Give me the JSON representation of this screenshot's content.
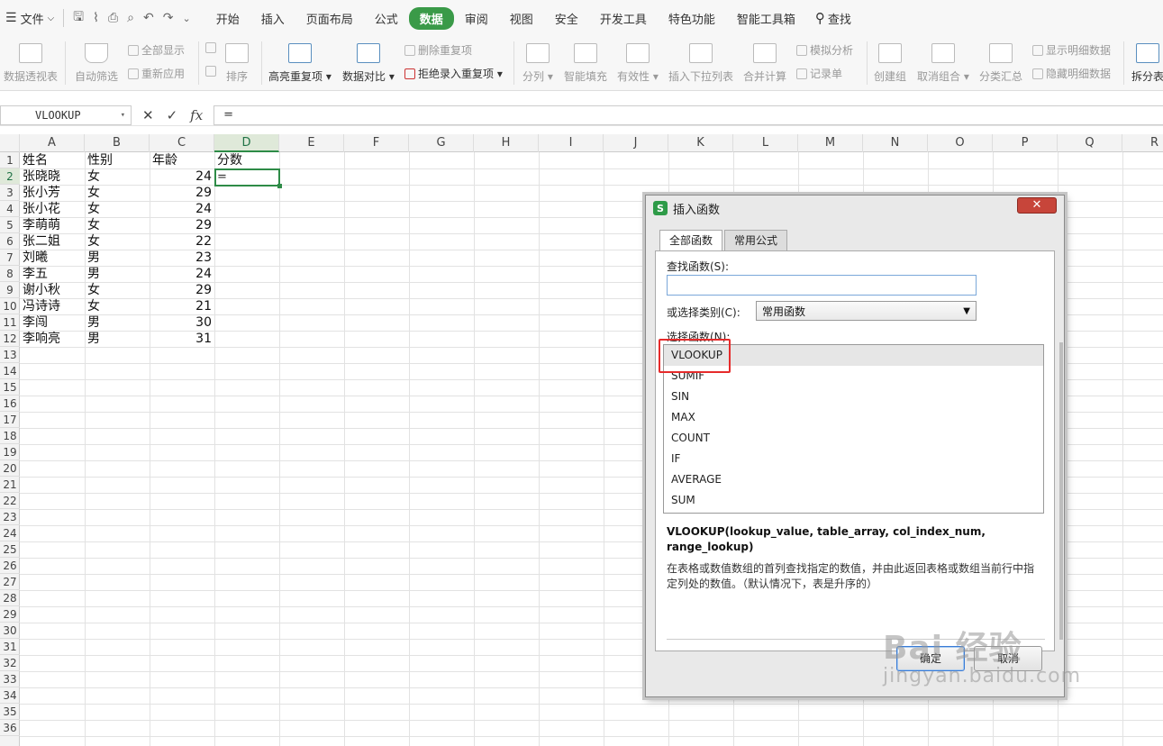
{
  "menubar": {
    "file_label": "文件",
    "tabs": [
      "开始",
      "插入",
      "页面布局",
      "公式",
      "数据",
      "审阅",
      "视图",
      "安全",
      "开发工具",
      "特色功能",
      "智能工具箱"
    ],
    "active_tab": "数据",
    "search_label": "查找"
  },
  "ribbon": {
    "pivot": "数据透视表",
    "autofilter": "自动筛选",
    "show_all": "全部显示",
    "reapply": "重新应用",
    "sort": "排序",
    "highlight_dup": "高亮重复项",
    "compare": "数据对比",
    "remove_dup": "删除重复项",
    "reject_dup": "拒绝录入重复项",
    "split": "分列",
    "smart_fill": "智能填充",
    "validity": "有效性",
    "dropdown": "插入下拉列表",
    "consolidate": "合并计算",
    "simulate": "模拟分析",
    "record": "记录单",
    "create_group": "创建组",
    "ungroup": "取消组合",
    "subtotal": "分类汇总",
    "show_detail": "显示明细数据",
    "hide_detail": "隐藏明细数据",
    "split_table": "拆分表"
  },
  "formula_bar": {
    "name_box": "VLOOKUP",
    "fx_label": "fx",
    "content": "="
  },
  "sheet": {
    "columns": [
      "A",
      "B",
      "C",
      "D",
      "E",
      "F",
      "G",
      "H",
      "I",
      "J",
      "K",
      "L",
      "M",
      "N",
      "O",
      "P",
      "Q",
      "R"
    ],
    "selected_column": "D",
    "rows": [
      "1",
      "2",
      "3",
      "4",
      "5",
      "6",
      "7",
      "8",
      "9",
      "10",
      "11",
      "12",
      "13",
      "14",
      "15",
      "16",
      "17",
      "18",
      "19",
      "20",
      "21",
      "22",
      "23",
      "24",
      "25",
      "26",
      "27",
      "28",
      "29",
      "30",
      "31",
      "32",
      "33",
      "34",
      "35",
      "36"
    ],
    "selected_row": "2",
    "headers": {
      "a": "姓名",
      "b": "性别",
      "c": "年龄",
      "d": "分数"
    },
    "data": [
      {
        "name": "张晓晓",
        "gender": "女",
        "age": "24"
      },
      {
        "name": "张小芳",
        "gender": "女",
        "age": "29"
      },
      {
        "name": "张小花",
        "gender": "女",
        "age": "24"
      },
      {
        "name": "李萌萌",
        "gender": "女",
        "age": "29"
      },
      {
        "name": "张二姐",
        "gender": "女",
        "age": "22"
      },
      {
        "name": "刘曦",
        "gender": "男",
        "age": "23"
      },
      {
        "name": "李五",
        "gender": "男",
        "age": "24"
      },
      {
        "name": "谢小秋",
        "gender": "女",
        "age": "29"
      },
      {
        "name": "冯诗诗",
        "gender": "女",
        "age": "21"
      },
      {
        "name": "李闯",
        "gender": "男",
        "age": "30"
      },
      {
        "name": "李响亮",
        "gender": "男",
        "age": "31"
      }
    ],
    "active_cell_value": "="
  },
  "dialog": {
    "title": "插入函数",
    "tab_all": "全部函数",
    "tab_common": "常用公式",
    "find_label": "查找函数(S):",
    "category_label": "或选择类别(C):",
    "category_value": "常用函数",
    "select_label": "选择函数(N):",
    "functions": [
      "VLOOKUP",
      "SUMIF",
      "SIN",
      "MAX",
      "COUNT",
      "IF",
      "AVERAGE",
      "SUM"
    ],
    "selected_function": "VLOOKUP",
    "signature": "VLOOKUP(lookup_value, table_array, col_index_num, range_lookup)",
    "description": "在表格或数值数组的首列查找指定的数值，并由此返回表格或数组当前行中指定列处的数值。（默认情况下，表是升序的）",
    "ok": "确定",
    "cancel": "取消",
    "close": "✕"
  },
  "watermark": {
    "brand": "Bai 经验",
    "url": "jingyan.baidu.com"
  }
}
